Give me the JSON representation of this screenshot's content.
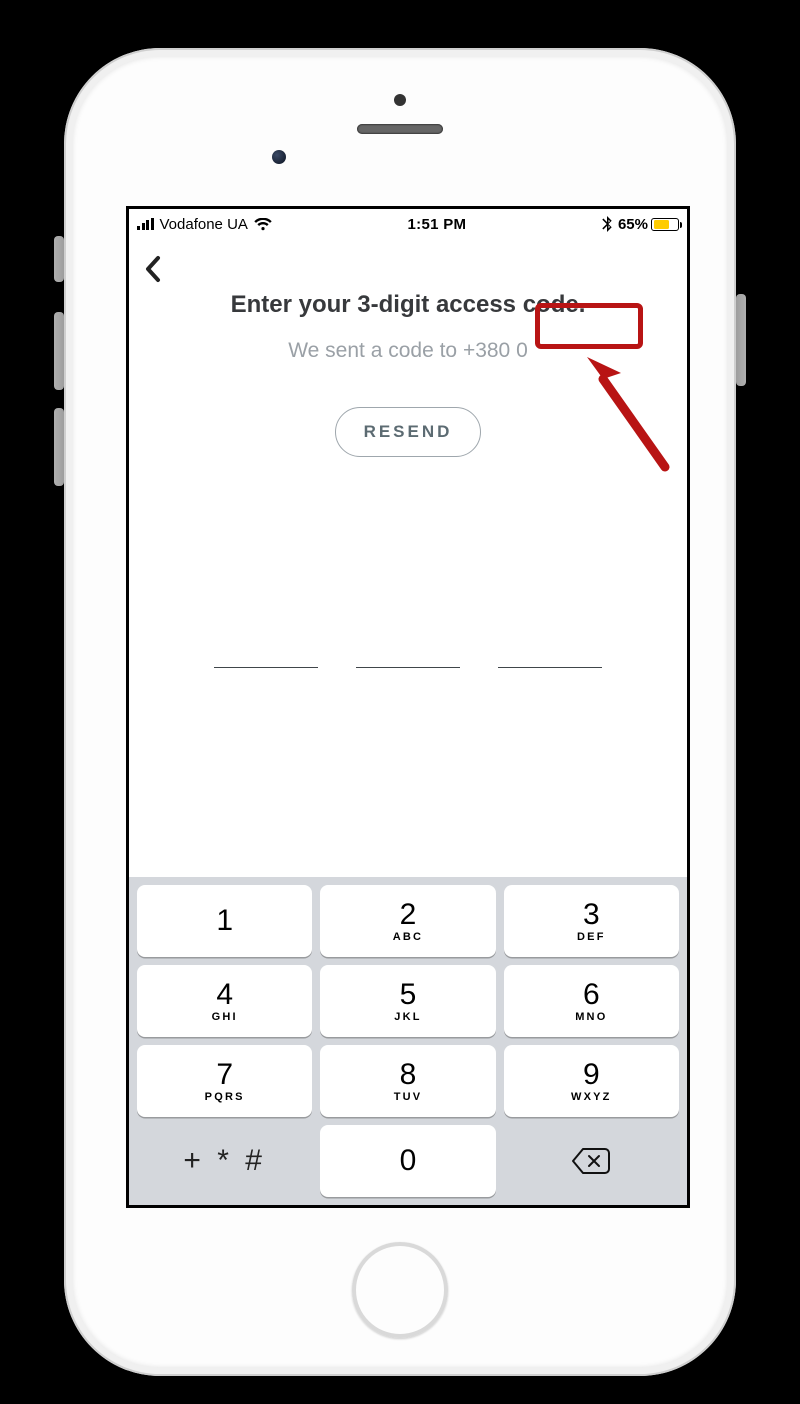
{
  "status": {
    "carrier": "Vodafone UA",
    "time": "1:51 PM",
    "battery_pct": "65%",
    "battery_fill_pct": 65,
    "battery_fill_color": "#ffcc00"
  },
  "content": {
    "title": "Enter your 3-digit access code.",
    "subtitle_prefix": "We sent a code to ",
    "phone": "+380 0",
    "resend_label": "RESEND"
  },
  "keypad": {
    "rows": [
      [
        {
          "num": "1",
          "sub": ""
        },
        {
          "num": "2",
          "sub": "ABC"
        },
        {
          "num": "3",
          "sub": "DEF"
        }
      ],
      [
        {
          "num": "4",
          "sub": "GHI"
        },
        {
          "num": "5",
          "sub": "JKL"
        },
        {
          "num": "6",
          "sub": "MNO"
        }
      ],
      [
        {
          "num": "7",
          "sub": "PQRS"
        },
        {
          "num": "8",
          "sub": "TUV"
        },
        {
          "num": "9",
          "sub": "WXYZ"
        }
      ]
    ],
    "symbols_label": "+ * #",
    "zero": "0"
  },
  "annotation": {
    "highlight_color": "#b81414"
  }
}
